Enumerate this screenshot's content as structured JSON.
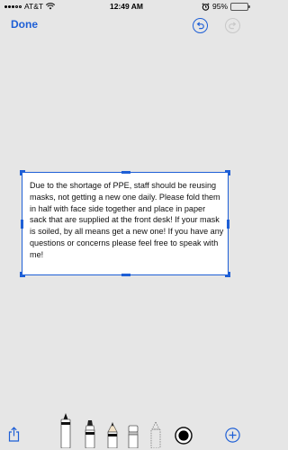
{
  "status_bar": {
    "carrier": "AT&T",
    "time": "12:49 AM",
    "battery_percent": "95%",
    "battery_level": 0.95,
    "battery_color": "#4cd964",
    "icons": [
      "signal-icon",
      "wifi-icon",
      "alarm-icon",
      "battery-icon"
    ]
  },
  "nav": {
    "done_label": "Done",
    "accent": "#1e5fd6",
    "undo_icon": "undo-icon",
    "redo_icon": "redo-icon"
  },
  "text_box": {
    "text": "Due to the shortage of PPE, staff should be reusing masks, not getting a new one daily. Please fold them in half with face side together and place in paper sack that are supplied at the front desk! If your mask is soiled, by all means get a new one! If you have any questions or concerns please feel free to speak with me!"
  },
  "toolbar": {
    "tools": [
      "share-icon",
      "pen-tool-icon",
      "marker-tool-icon",
      "pencil-tool-icon",
      "eraser-tool-icon",
      "lasso-tool-icon",
      "color-picker-icon",
      "add-icon"
    ],
    "selected_color": "#000000"
  }
}
